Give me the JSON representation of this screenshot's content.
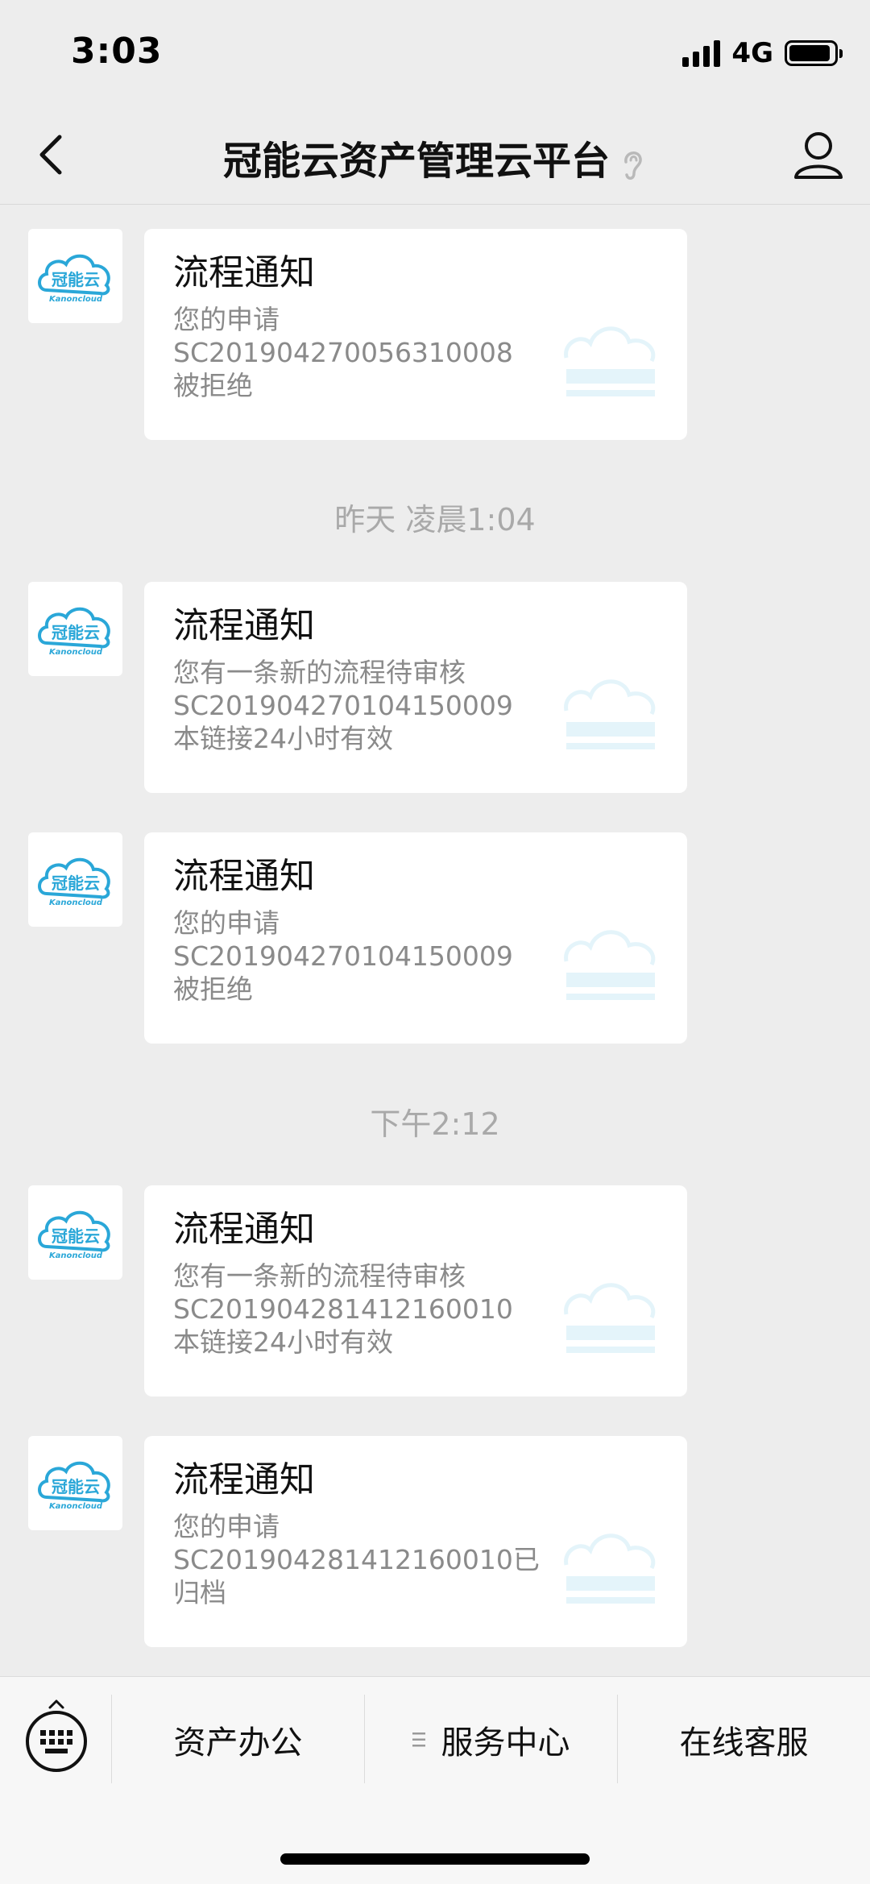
{
  "status_bar": {
    "time": "3:03",
    "network": "4G",
    "icons": [
      "signal-icon",
      "battery-icon"
    ]
  },
  "nav": {
    "title": "冠能云资产管理云平台",
    "icons": [
      "back-chevron-icon",
      "ear-icon",
      "profile-icon"
    ]
  },
  "avatar": {
    "logo_text": "冠能云",
    "logo_subtext": "Kanoncloud",
    "icon": "cloud-logo-icon"
  },
  "timestamps": [
    "昨天 凌晨1:04",
    "下午2:12"
  ],
  "messages": [
    {
      "title": "流程通知",
      "lines": [
        "您的申请",
        "SC201904270056310008",
        "被拒绝"
      ]
    },
    {
      "title": "流程通知",
      "lines": [
        "您有一条新的流程待审核",
        "SC201904270104150009",
        "本链接24小时有效"
      ]
    },
    {
      "title": "流程通知",
      "lines": [
        "您的申请",
        "SC201904270104150009",
        "被拒绝"
      ]
    },
    {
      "title": "流程通知",
      "lines": [
        "您有一条新的流程待审核",
        "SC201904281412160010",
        "本链接24小时有效"
      ]
    },
    {
      "title": "流程通知",
      "lines": [
        "您的申请",
        "SC201904281412160010已",
        "归档"
      ]
    }
  ],
  "bottom_menu": {
    "items": [
      {
        "label": "资产办公"
      },
      {
        "label": "服务中心",
        "icon": "menu-lines-icon"
      },
      {
        "label": "在线客服"
      }
    ],
    "icons": [
      "keyboard-icon"
    ]
  },
  "colors": {
    "background": "#ededed",
    "bubble": "#ffffff",
    "secondary_text": "#8a8a8a",
    "timestamp_text": "#a9a9a9",
    "logo_blue": "#2aa7d8"
  }
}
